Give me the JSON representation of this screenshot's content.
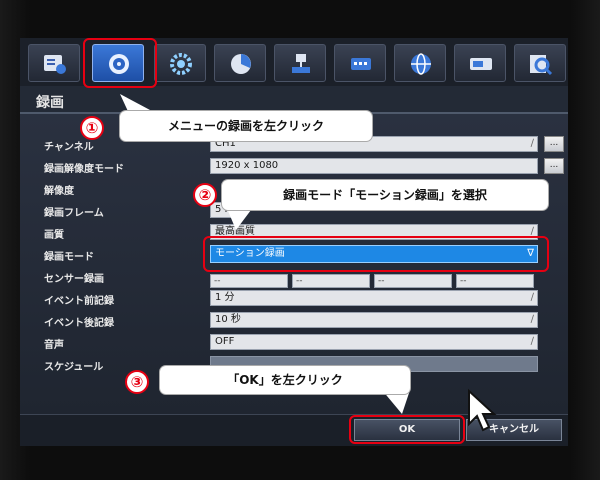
{
  "section_title": "録画",
  "tabs": [
    "record-settings",
    "camera-settings",
    "gear-settings",
    "disk-settings",
    "network-settings",
    "event-settings",
    "web-settings",
    "system-settings",
    "search-settings"
  ],
  "fields": {
    "channel": {
      "label": "チャンネル",
      "value": "CH1"
    },
    "record_resolution_mode": {
      "label": "録画解像度モード",
      "value": "1920 x 1080"
    },
    "resolution": {
      "label": "解像度",
      "value": ""
    },
    "record_frame": {
      "label": "録画フレーム",
      "value": "5 FPS"
    },
    "quality": {
      "label": "画質",
      "value": "最高画質"
    },
    "record_mode": {
      "label": "録画モード",
      "value": "モーション録画"
    },
    "sensor_record": {
      "label": "センサー録画",
      "values": [
        "--",
        "--",
        "--",
        "--"
      ]
    },
    "pre_event": {
      "label": "イベント前記録",
      "value": "1 分"
    },
    "post_event": {
      "label": "イベント後記録",
      "value": "10 秒"
    },
    "audio": {
      "label": "音声",
      "value": "OFF"
    },
    "schedule": {
      "label": "スケジュール",
      "value": ""
    }
  },
  "dots_label": "...",
  "buttons": {
    "ok": "OK",
    "cancel": "キャンセル"
  },
  "annotations": {
    "step1": {
      "number": "①",
      "text": "メニューの録画を左クリック"
    },
    "step2": {
      "number": "②",
      "text": "録画モード「モーション録画」を選択"
    },
    "step3": {
      "number": "③",
      "text": "「OK」を左クリック"
    }
  },
  "colors": {
    "accent_red": "#e60012",
    "selected_blue": "#1e88e5",
    "active_tab": "#3b78d8"
  }
}
